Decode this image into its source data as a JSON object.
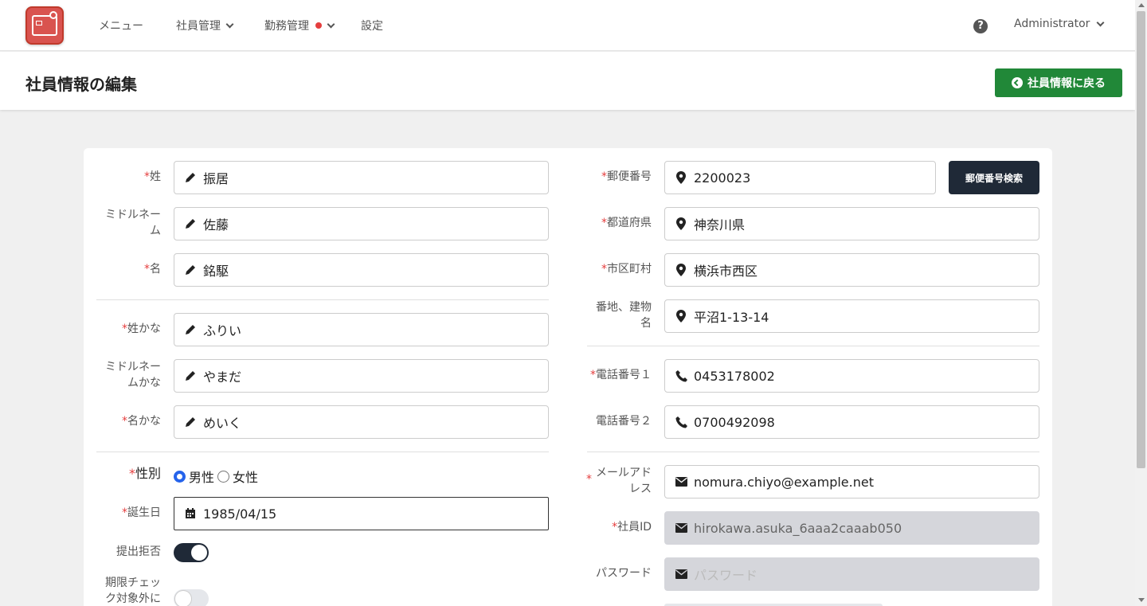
{
  "nav": {
    "items": [
      {
        "label": "メニュー"
      },
      {
        "label": "社員管理"
      },
      {
        "label": "勤務管理"
      },
      {
        "label": "設定"
      }
    ],
    "user": "Administrator"
  },
  "header": {
    "title": "社員情報の編集",
    "back_label": "社員情報に戻る"
  },
  "left": {
    "last_name": {
      "label": "姓",
      "value": "振居"
    },
    "middle_name": {
      "label": "ミドルネーム",
      "value": "佐藤"
    },
    "first_name": {
      "label": "名",
      "value": "銘駆"
    },
    "last_name_kana": {
      "label": "姓かな",
      "value": "ふりい"
    },
    "middle_name_kana": {
      "label": "ミドルネームかな",
      "value": "やまだ"
    },
    "first_name_kana": {
      "label": "名かな",
      "value": "めいく"
    },
    "gender": {
      "label": "性別",
      "male": "男性",
      "female": "女性",
      "selected": "男性"
    },
    "birthday": {
      "label": "誕生日",
      "value": "1985/04/15"
    },
    "refuse_submit": {
      "label": "提出拒否",
      "on": true
    },
    "deadline_exclude": {
      "label": "期限チェック対象外に",
      "on": false
    }
  },
  "right": {
    "postal_code": {
      "label": "郵便番号",
      "value": "2200023"
    },
    "postal_search": "郵便番号検索",
    "prefecture": {
      "label": "都道府県",
      "value": "神奈川県"
    },
    "city": {
      "label": "市区町村",
      "value": "横浜市西区"
    },
    "address": {
      "label": "番地、建物名",
      "value": "平沼1-13-14"
    },
    "phone1": {
      "label": "電話番号１",
      "value": "0453178002"
    },
    "phone2": {
      "label": "電話番号２",
      "value": "0700492098"
    },
    "email": {
      "label": "メールアドレス",
      "value": "nomura.chiyo@example.net"
    },
    "employee_id": {
      "label": "社員ID",
      "value": "hirokawa.asuka_6aaa2caaab050"
    },
    "password": {
      "label": "パスワード",
      "placeholder": "パスワード"
    }
  },
  "colors": {
    "primary_green": "#218838",
    "dark": "#1f2937",
    "required": "#e53e3e",
    "radio": "#2563eb"
  }
}
